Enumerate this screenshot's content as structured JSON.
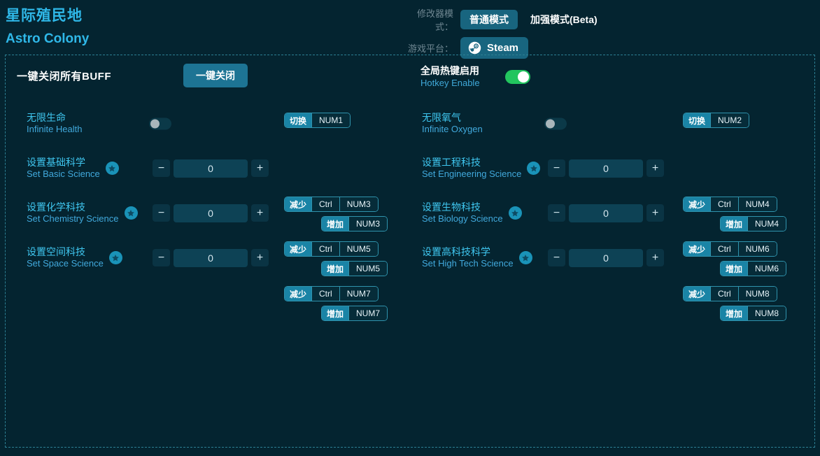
{
  "app": {
    "title_cn": "星际殖民地",
    "title_en": "Astro Colony",
    "accent": "#2fb8e8",
    "bg": "#042430"
  },
  "header": {
    "mode_label": "修改器模式：",
    "mode_selected": "普通模式",
    "mode_other": "加强模式(Beta)",
    "platform_label": "游戏平台：",
    "platform_value": "Steam",
    "platform_icon": "steam-icon"
  },
  "close_all": {
    "label": "一键关闭所有BUFF",
    "button": "一键关闭"
  },
  "hotkey_enable": {
    "label_cn": "全局热键启用",
    "label_en": "Hotkey Enable",
    "state": "on",
    "on_color": "#22c55e"
  },
  "left_column": [
    {
      "cn": "无限生命",
      "en": "Infinite Health",
      "type": "toggle",
      "state": "off",
      "star": false,
      "chips": [
        {
          "action": "切换",
          "keys": [
            "NUM1"
          ],
          "align": "left"
        }
      ]
    },
    {
      "cn": "设置基础科学",
      "en": "Set Basic Science",
      "type": "stepper",
      "value": "0",
      "minus": "−",
      "plus": "+",
      "star": true,
      "chips": [
        {
          "action": "减少",
          "keys": [
            "Ctrl",
            "NUM3"
          ],
          "align": "left"
        },
        {
          "action": "增加",
          "keys": [
            "NUM3"
          ],
          "align": "right"
        }
      ]
    },
    {
      "cn": "设置化学科技",
      "en": "Set Chemistry Science",
      "type": "stepper",
      "value": "0",
      "minus": "−",
      "plus": "+",
      "star": true,
      "chips": [
        {
          "action": "减少",
          "keys": [
            "Ctrl",
            "NUM5"
          ],
          "align": "left"
        },
        {
          "action": "增加",
          "keys": [
            "NUM5"
          ],
          "align": "right"
        }
      ]
    },
    {
      "cn": "设置空间科技",
      "en": "Set Space Science",
      "type": "stepper",
      "value": "0",
      "minus": "−",
      "plus": "+",
      "star": true,
      "chips": [
        {
          "action": "减少",
          "keys": [
            "Ctrl",
            "NUM7"
          ],
          "align": "left"
        },
        {
          "action": "增加",
          "keys": [
            "NUM7"
          ],
          "align": "right"
        }
      ]
    }
  ],
  "right_column": [
    {
      "cn": "无限氧气",
      "en": "Infinite Oxygen",
      "type": "toggle",
      "state": "off",
      "star": false,
      "chips": [
        {
          "action": "切换",
          "keys": [
            "NUM2"
          ],
          "align": "left"
        }
      ]
    },
    {
      "cn": "设置工程科技",
      "en": "Set Engineering Science",
      "type": "stepper",
      "value": "0",
      "minus": "−",
      "plus": "+",
      "star": true,
      "chips": [
        {
          "action": "减少",
          "keys": [
            "Ctrl",
            "NUM4"
          ],
          "align": "left"
        },
        {
          "action": "增加",
          "keys": [
            "NUM4"
          ],
          "align": "right"
        }
      ]
    },
    {
      "cn": "设置生物科技",
      "en": "Set Biology Science",
      "type": "stepper",
      "value": "0",
      "minus": "−",
      "plus": "+",
      "star": true,
      "chips": [
        {
          "action": "减少",
          "keys": [
            "Ctrl",
            "NUM6"
          ],
          "align": "left"
        },
        {
          "action": "增加",
          "keys": [
            "NUM6"
          ],
          "align": "right"
        }
      ]
    },
    {
      "cn": "设置高科技科学",
      "en": "Set High Tech Science",
      "type": "stepper",
      "value": "0",
      "minus": "−",
      "plus": "+",
      "star": true,
      "chips": [
        {
          "action": "减少",
          "keys": [
            "Ctrl",
            "NUM8"
          ],
          "align": "left"
        },
        {
          "action": "增加",
          "keys": [
            "NUM8"
          ],
          "align": "right"
        }
      ]
    }
  ]
}
